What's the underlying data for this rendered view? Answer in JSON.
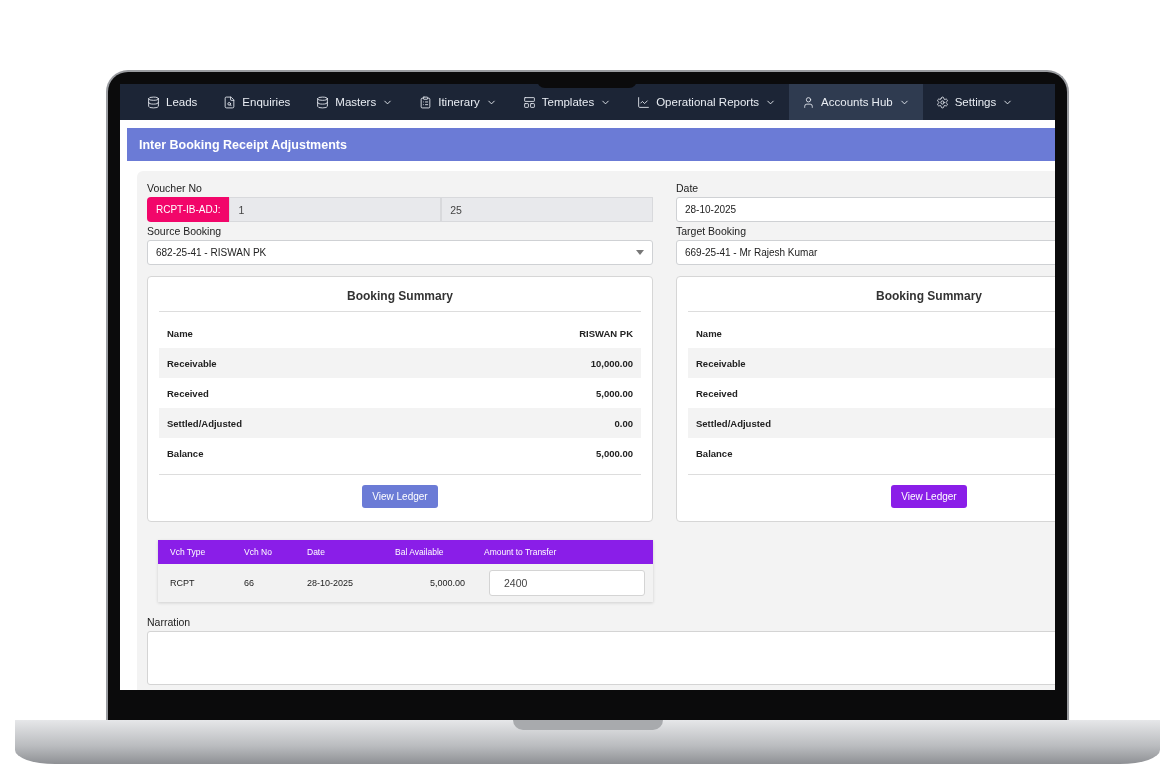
{
  "nav": [
    {
      "label": "Leads",
      "has_menu": false,
      "selected": false
    },
    {
      "label": "Enquiries",
      "has_menu": false,
      "selected": false
    },
    {
      "label": "Masters",
      "has_menu": true,
      "selected": false
    },
    {
      "label": "Itinerary",
      "has_menu": true,
      "selected": false
    },
    {
      "label": "Templates",
      "has_menu": true,
      "selected": false
    },
    {
      "label": "Operational Reports",
      "has_menu": true,
      "selected": false
    },
    {
      "label": "Accounts Hub",
      "has_menu": true,
      "selected": true
    },
    {
      "label": "Settings",
      "has_menu": true,
      "selected": false
    }
  ],
  "panel": {
    "title": "Inter Booking Receipt Adjustments"
  },
  "voucher": {
    "label": "Voucher No",
    "prefix": "RCPT-IB-ADJ:",
    "number": "1",
    "year": "25"
  },
  "date": {
    "label": "Date",
    "value": "28-10-2025"
  },
  "source": {
    "label": "Source Booking",
    "value": "682-25-41 - RISWAN PK"
  },
  "target": {
    "label": "Target Booking",
    "value": "669-25-41 - Mr Rajesh Kumar"
  },
  "summaries": [
    {
      "title": "Booking Summary",
      "button": {
        "label": "View Ledger",
        "color": "#6b7bd6"
      },
      "rows": [
        {
          "label": "Name",
          "value": "RISWAN PK"
        },
        {
          "label": "Receivable",
          "value": "10,000.00"
        },
        {
          "label": "Received",
          "value": "5,000.00"
        },
        {
          "label": "Settled/Adjusted",
          "value": "0.00"
        },
        {
          "label": "Balance",
          "value": "5,000.00"
        }
      ]
    },
    {
      "title": "Booking Summary",
      "button": {
        "label": "View Ledger",
        "color": "#8a1ee8"
      },
      "rows": [
        {
          "label": "Name"
        },
        {
          "label": "Receivable"
        },
        {
          "label": "Received"
        },
        {
          "label": "Settled/Adjusted"
        },
        {
          "label": "Balance"
        }
      ]
    }
  ],
  "transfer_table": {
    "columns": [
      "Vch Type",
      "Vch No",
      "Date",
      "Bal Available",
      "Amount to Transfer"
    ],
    "rows": [
      {
        "vch_type": "RCPT",
        "vch_no": "66",
        "date": "28-10-2025",
        "bal_available": "5,000.00",
        "amount": "2400"
      }
    ]
  },
  "narration": {
    "label": "Narration"
  }
}
